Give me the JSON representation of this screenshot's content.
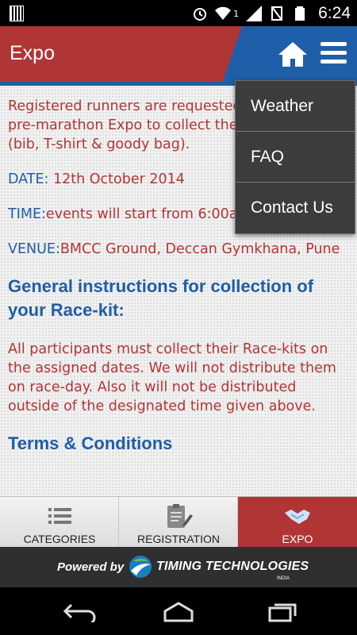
{
  "status_bar": {
    "time": "6:24",
    "notification": "1"
  },
  "header": {
    "title": "Expo",
    "home_icon": "home-icon",
    "menu_icon": "menu-icon"
  },
  "content": {
    "intro": "Registered runners are requested to visit the pre-marathon Expo to collect the marathon kit (bib, T-shirt & goody bag).",
    "date_label": "DATE:",
    "date_value": " 12th October 2014",
    "time_label": "TIME:",
    "time_value": "events will start from 6:00am onwards",
    "venue_label": "VENUE:",
    "venue_value": "BMCC Ground, Deccan Gymkhana, Pune",
    "instructions_heading": "General instructions for collection of your Race-kit:",
    "instructions_text": "All participants must collect their Race-kits on the assigned dates. We will not distribute them on race-day. Also it will not be distributed outside of the designated time given above.",
    "terms_heading": "Terms & Conditions"
  },
  "dropdown": {
    "items": [
      "Weather",
      "FAQ",
      "Contact Us"
    ]
  },
  "tabs": [
    {
      "label": "CATEGORIES",
      "icon": "list-icon"
    },
    {
      "label": "REGISTRATION",
      "icon": "clipboard-icon"
    },
    {
      "label": "EXPO",
      "icon": "handshake-icon"
    }
  ],
  "active_tab": "EXPO",
  "footer": {
    "powered_by": "Powered by",
    "brand": "TIMING TECHNOLOGIES",
    "brand_sub": "INDIA"
  },
  "colors": {
    "brand_red": "#b23536",
    "brand_blue": "#1f5ea8"
  }
}
